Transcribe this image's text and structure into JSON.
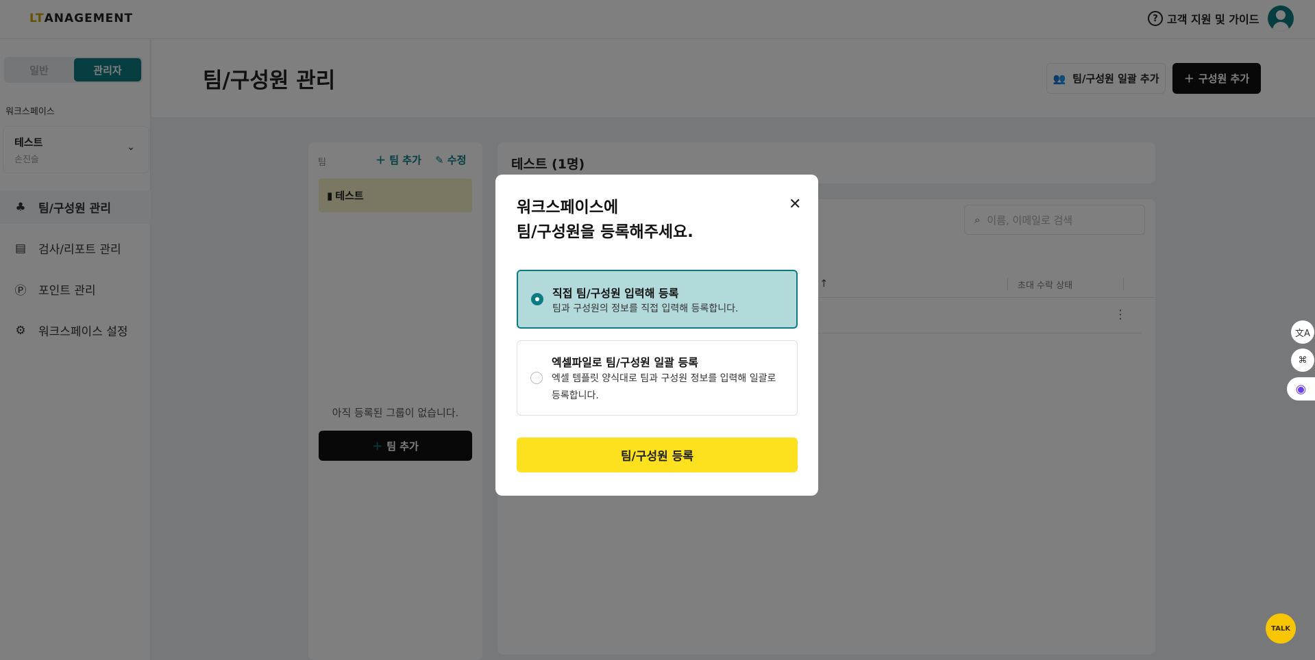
{
  "header": {
    "logo_prefix": "LT",
    "logo_text": "ANAGEMENT",
    "help_label": "고객 지원 및 가이드"
  },
  "sidebar": {
    "toggle": {
      "general": "일반",
      "admin": "관리자"
    },
    "workspace_label": "워크스페이스",
    "workspace": {
      "name": "테스트",
      "owner": "손진슬"
    },
    "items": [
      {
        "label": "팀/구성원 관리",
        "icon": "org-chart-icon"
      },
      {
        "label": "검사/리포트 관리",
        "icon": "report-icon"
      },
      {
        "label": "포인트 관리",
        "icon": "point-icon"
      },
      {
        "label": "워크스페이스 설정",
        "icon": "gear-icon"
      }
    ]
  },
  "page": {
    "title": "팀/구성원 관리",
    "bulk_add": "팀/구성원 일괄 추가",
    "add_member": "구성원 추가"
  },
  "team_panel": {
    "label": "팀",
    "add": "팀 추가",
    "edit": "수정",
    "team": "테스트",
    "empty": "아직 등록된 그룹이 없습니다.",
    "add_button": "팀 추가"
  },
  "member_panel": {
    "title": "테스트 (1명)",
    "search_placeholder": "이름, 이메일로 검색",
    "column_invite_status": "초대 수락 상태"
  },
  "modal": {
    "title_line1": "워크스페이스에",
    "title_line2": "팀/구성원을 등록해주세요.",
    "options": [
      {
        "title": "직접 팀/구성원 입력해 등록",
        "desc": "팀과 구성원의 정보를 직접 입력해 등록합니다.",
        "selected": true
      },
      {
        "title": "엑셀파일로 팀/구성원 일괄 등록",
        "desc": "엑셀 템플릿 양식대로 팀과 구성원 정보를 입력해 일괄로 등록합니다.",
        "selected": false
      }
    ],
    "submit": "팀/구성원 등록"
  },
  "floating": {
    "kakao": "TALK"
  },
  "colors": {
    "accent": "#0a7b80",
    "yellow": "#fde11e",
    "selected_bg": "#b2dadb"
  }
}
